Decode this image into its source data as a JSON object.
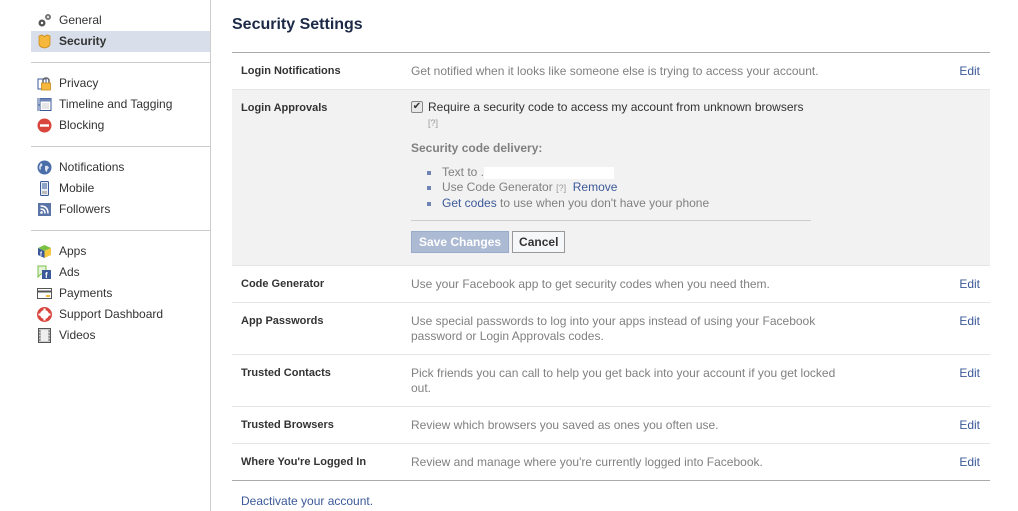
{
  "sidebar": {
    "groups": [
      [
        {
          "label": "General",
          "icon": "gears-icon"
        },
        {
          "label": "Security",
          "icon": "shield-icon",
          "active": true
        }
      ],
      [
        {
          "label": "Privacy",
          "icon": "padlock-icon"
        },
        {
          "label": "Timeline and Tagging",
          "icon": "timeline-icon"
        },
        {
          "label": "Blocking",
          "icon": "blocking-icon"
        }
      ],
      [
        {
          "label": "Notifications",
          "icon": "globe-icon"
        },
        {
          "label": "Mobile",
          "icon": "mobile-phone-icon"
        },
        {
          "label": "Followers",
          "icon": "rss-icon"
        }
      ],
      [
        {
          "label": "Apps",
          "icon": "apps-cube-icon"
        },
        {
          "label": "Ads",
          "icon": "ads-icon"
        },
        {
          "label": "Payments",
          "icon": "credit-card-icon"
        },
        {
          "label": "Support Dashboard",
          "icon": "lifebuoy-icon"
        },
        {
          "label": "Videos",
          "icon": "film-icon"
        }
      ]
    ]
  },
  "main": {
    "title": "Security Settings",
    "edit_label": "Edit",
    "rows": {
      "login_notifications": {
        "label": "Login Notifications",
        "desc": "Get notified when it looks like someone else is trying to access your account."
      },
      "login_approvals": {
        "label": "Login Approvals",
        "checkbox_checked": true,
        "checkbox_label": "Require a security code to access my account from unknown browsers",
        "help": "[?]",
        "delivery_title": "Security code delivery:",
        "text_to": "Text to .",
        "code_generator": "Use Code Generator",
        "code_generator_help": "[?]",
        "remove": "Remove",
        "get_codes_link": "Get codes",
        "get_codes_rest": " to use when you don't have your phone",
        "save": "Save Changes",
        "cancel": "Cancel"
      },
      "code_generator": {
        "label": "Code Generator",
        "desc": "Use your Facebook app to get security codes when you need them."
      },
      "app_passwords": {
        "label": "App Passwords",
        "desc": "Use special passwords to log into your apps instead of using your Facebook password or Login Approvals codes."
      },
      "trusted_contacts": {
        "label": "Trusted Contacts",
        "desc": "Pick friends you can call to help you get back into your account if you get locked out."
      },
      "trusted_browsers": {
        "label": "Trusted Browsers",
        "desc": "Review which browsers you saved as ones you often use."
      },
      "where_logged_in": {
        "label": "Where You're Logged In",
        "desc": "Review and manage where you're currently logged into Facebook."
      }
    },
    "deactivate": "Deactivate your account."
  }
}
